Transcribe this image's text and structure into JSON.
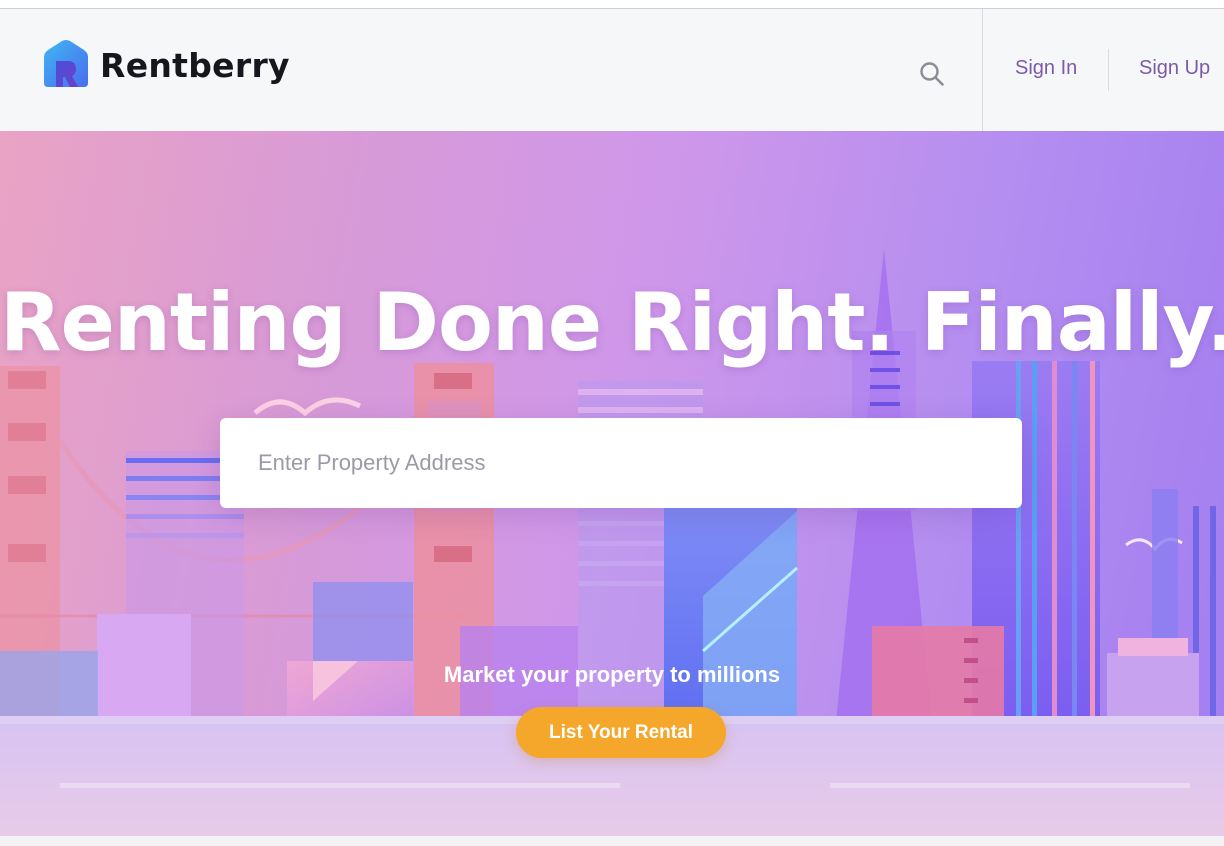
{
  "header": {
    "brand_name": "Rentberry",
    "logo_icon": "house-r-logo-icon",
    "search_icon": "search-icon",
    "nav": {
      "sign_in": "Sign In",
      "sign_up": "Sign Up"
    }
  },
  "hero": {
    "title": "Renting Done Right. Finally.",
    "search_placeholder": "Enter Property Address",
    "tagline": "Market your property to millions",
    "cta_label": "List Your Rental"
  },
  "colors": {
    "accent_cta": "#f4a72a",
    "nav_link": "#7c5aa6",
    "hero_gradient_start": "#e9a3c4",
    "hero_gradient_end": "#a27ef0"
  }
}
